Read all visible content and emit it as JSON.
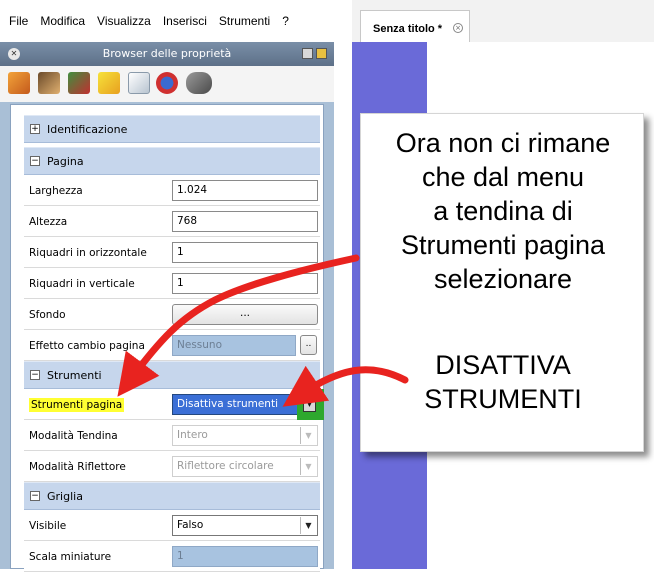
{
  "menu": [
    "File",
    "Modifica",
    "Visualizza",
    "Inserisci",
    "Strumenti",
    "?"
  ],
  "tab": {
    "label": "Senza titolo *",
    "close_glyph": "×"
  },
  "panel": {
    "title": "Browser delle proprietà",
    "toolbar_icons": [
      "wizard-icon",
      "transition-icon",
      "theme-icon",
      "fill-icon",
      "page-icon",
      "tool-icon",
      "audio-icon"
    ],
    "sections": [
      {
        "label": "Identificazione",
        "expander": "+",
        "rows": []
      },
      {
        "label": "Pagina",
        "expander": "−",
        "rows": [
          {
            "label": "Larghezza",
            "value": "1.024"
          },
          {
            "label": "Altezza",
            "value": "768"
          },
          {
            "label": "Riquadri in orizzontale",
            "value": "1"
          },
          {
            "label": "Riquadri in verticale",
            "value": "1"
          },
          {
            "label": "Sfondo",
            "value": "..."
          },
          {
            "label": "Effetto cambio pagina",
            "value": "Nessuno",
            "extra": ".."
          }
        ]
      },
      {
        "label": "Strumenti",
        "expander": "−",
        "rows": [
          {
            "label": "Strumenti pagina",
            "value": "Disattiva strumenti"
          },
          {
            "label": "Modalità Tendina",
            "value": "Intero"
          },
          {
            "label": "Modalità Riflettore",
            "value": "Riflettore circolare"
          }
        ]
      },
      {
        "label": "Griglia",
        "expander": "−",
        "rows": [
          {
            "label": "Visibile",
            "value": "Falso"
          },
          {
            "label": "Scala miniature",
            "value": "1"
          }
        ]
      }
    ]
  },
  "callout": {
    "lines1": [
      "Ora non ci rimane",
      "che dal menu",
      "a tendina di",
      "Strumenti pagina",
      "selezionare"
    ],
    "lines2": [
      "DISATTIVA",
      "STRUMENTI"
    ]
  },
  "colors": {
    "arrow": "#e8231f",
    "highlight": "#ffff33",
    "canvas": "#6a6ad8",
    "selection": "#3b6fd6",
    "green_box": "#2ea82e"
  }
}
